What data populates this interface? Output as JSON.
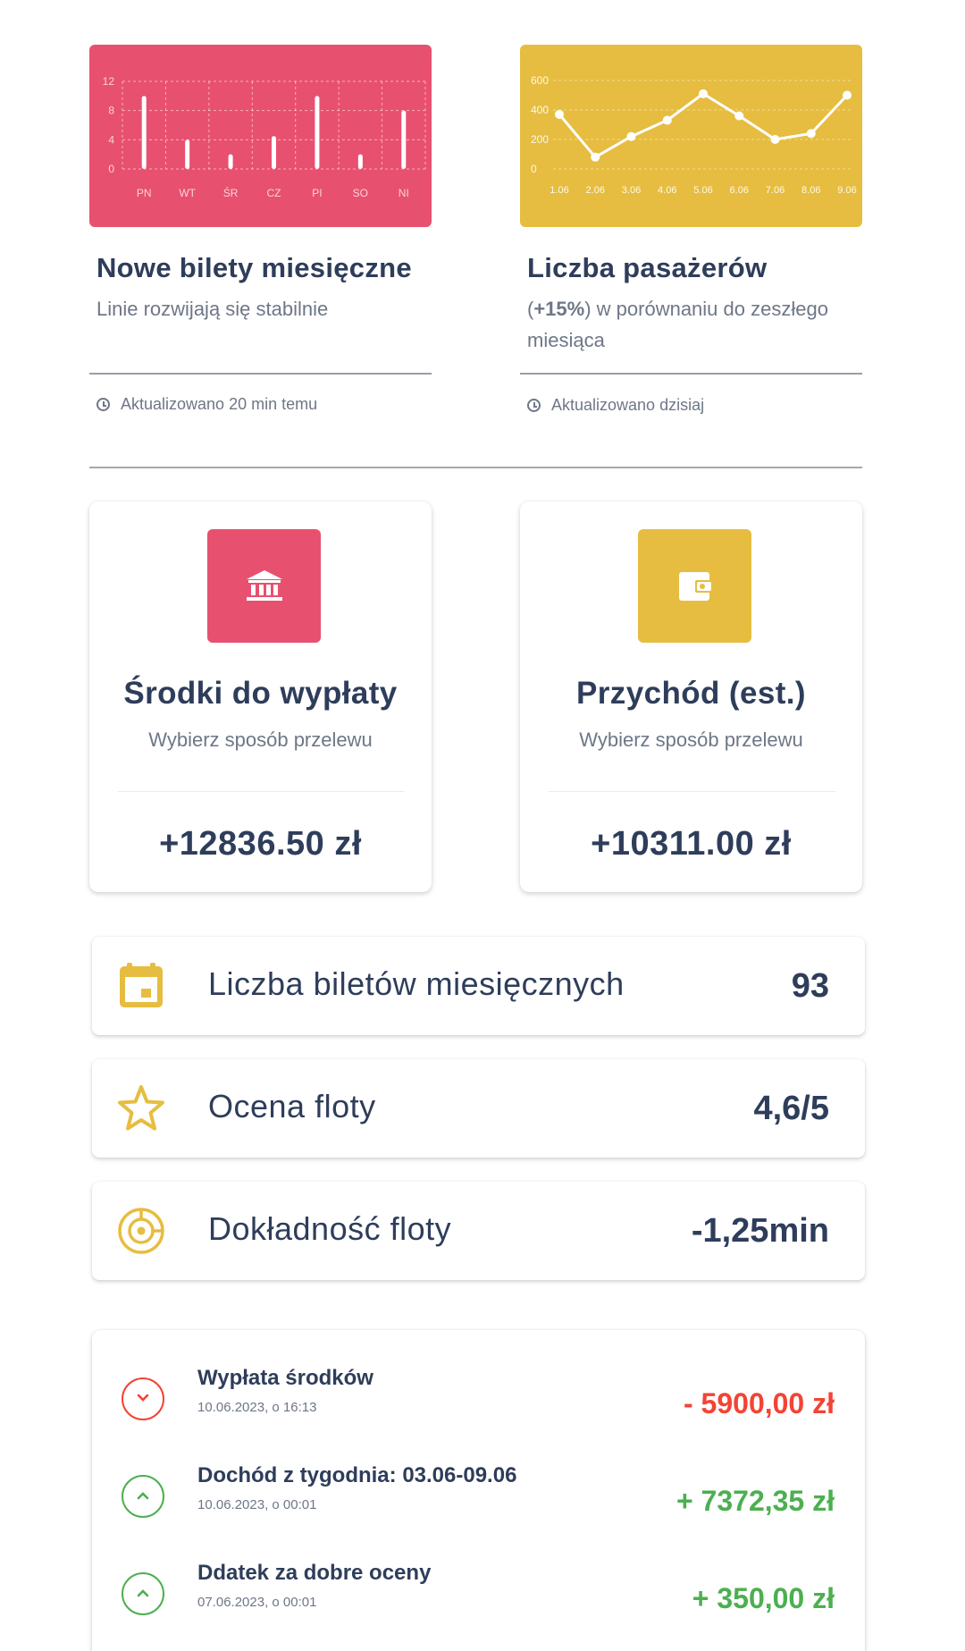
{
  "colors": {
    "red": "#e8506f",
    "yellow": "#e6bd40",
    "negative": "#f44335",
    "positive": "#4caf50",
    "dark_text": "#2e3d5a",
    "muted_text": "#6e7787"
  },
  "cards": [
    {
      "title": "Nowe bilety miesięczne",
      "subtitle": "Linie rozwijają się stabilnie",
      "updated": "Aktualizowano 20 min temu",
      "chart_data": {
        "type": "bar",
        "categories": [
          "PN",
          "WT",
          "ŚR",
          "CZ",
          "PI",
          "SO",
          "NI"
        ],
        "values": [
          10,
          4,
          2,
          4.5,
          10,
          2,
          8
        ],
        "y_ticks": [
          "0",
          "4",
          "8",
          "12"
        ],
        "ylim": [
          0,
          12
        ],
        "grid": true,
        "title": "",
        "xlabel": "",
        "ylabel": ""
      }
    },
    {
      "title": "Liczba pasażerów",
      "subtitle_strong": "+15%",
      "subtitle_prefix": "(",
      "subtitle_rest": ") w porównaniu do zeszłego miesiąca",
      "updated": "Aktualizowano dzisiaj",
      "chart_data": {
        "type": "line",
        "categories": [
          "1.06",
          "2.06",
          "3.06",
          "4.06",
          "5.06",
          "6.06",
          "7.06",
          "8.06",
          "9.06"
        ],
        "values": [
          370,
          80,
          220,
          330,
          510,
          360,
          200,
          240,
          500
        ],
        "y_ticks": [
          "0",
          "200",
          "400",
          "600"
        ],
        "ylim": [
          0,
          600
        ],
        "grid": true,
        "title": "",
        "xlabel": "",
        "ylabel": ""
      }
    }
  ],
  "stats": [
    {
      "icon": "bank-icon",
      "title": "Środki do wypłaty",
      "subtitle": "Wybierz sposób przelewu",
      "value": "+12836.50 zł"
    },
    {
      "icon": "wallet-icon",
      "title": "Przychód (est.)",
      "subtitle": "Wybierz sposób przelewu",
      "value": "+10311.00 zł"
    }
  ],
  "metrics": [
    {
      "icon": "calendar-icon",
      "label": "Liczba biletów miesięcznych",
      "value": "93"
    },
    {
      "icon": "star-icon",
      "label": "Ocena floty",
      "value": "4,6/5"
    },
    {
      "icon": "target-icon",
      "label": "Dokładność floty",
      "value": "-1,25min"
    }
  ],
  "transactions": [
    {
      "direction": "down",
      "title": "Wypłata środków",
      "date": "10.06.2023, o 16:13",
      "amount": "- 5900,00 zł"
    },
    {
      "direction": "up",
      "title": "Dochód z tygodnia: 03.06-09.06",
      "date": "10.06.2023, o 00:01",
      "amount": "+ 7372,35 zł"
    },
    {
      "direction": "up",
      "title": "Ddatek za dobre oceny",
      "date": "07.06.2023, o 00:01",
      "amount": "+ 350,00 zł"
    }
  ]
}
